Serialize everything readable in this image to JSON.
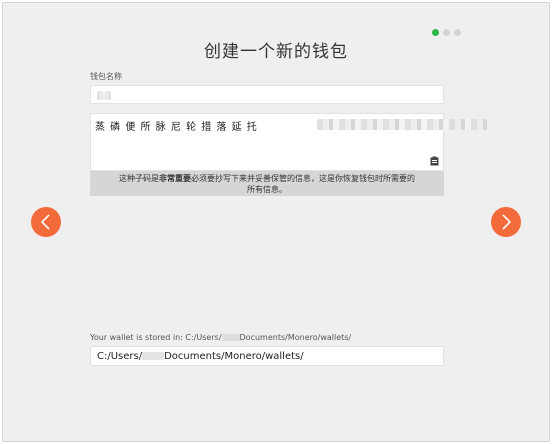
{
  "wizard": {
    "title": "创建一个新的钱包",
    "step_dots": [
      true,
      false,
      false
    ],
    "accent_color": "#2db64a",
    "nav_color": "#f36b3a"
  },
  "wallet_name": {
    "label": "钱包名称",
    "value": ""
  },
  "seed": {
    "visible_words": "蒸 磷 便 所 脉 尼 轮 措 落 延 托",
    "notice_prefix": "这种子码是",
    "notice_bold": "非常重要",
    "notice_suffix": "必须要抄写下来并妥善保管的信息，这是你恢复钱包时所需要的",
    "notice_line2": "所有信息。"
  },
  "location": {
    "label_prefix": "Your wallet is stored in: C:/Users/",
    "label_suffix": "Documents/Monero/wallets/",
    "path_prefix": "C:/Users/",
    "path_suffix": "Documents/Monero/wallets/"
  },
  "icons": {
    "prev": "chevron-left-icon",
    "next": "chevron-right-icon",
    "clipboard": "clipboard-icon"
  }
}
